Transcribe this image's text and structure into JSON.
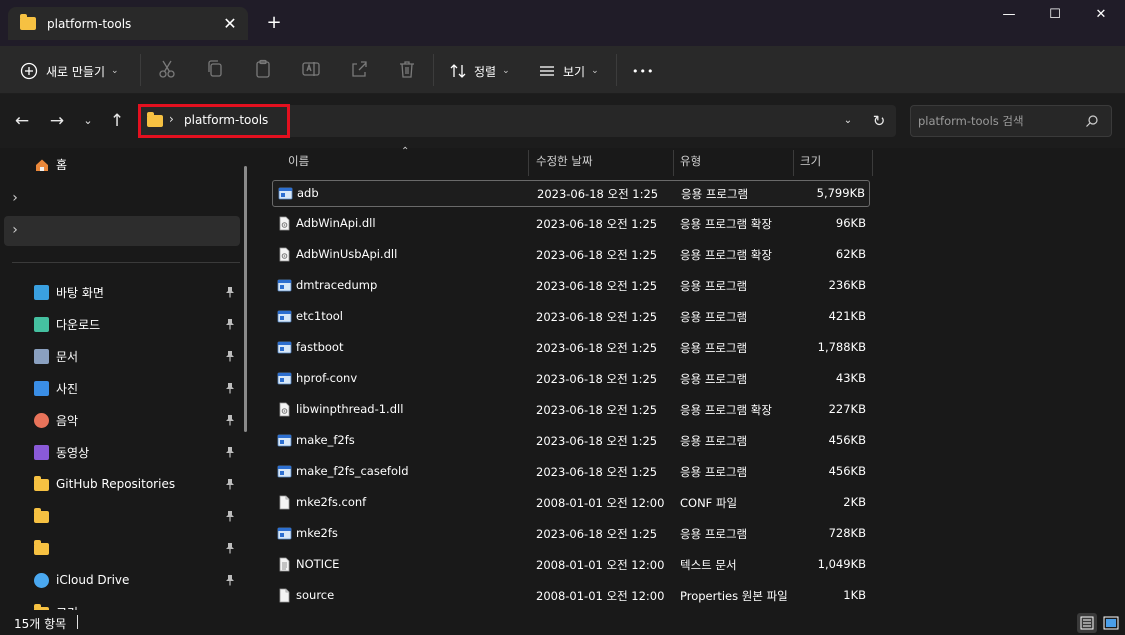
{
  "window": {
    "tab_title": "platform-tools",
    "new_tab": "+",
    "close_tab": "✕",
    "minimize": "—",
    "maximize": "☐",
    "close": "✕"
  },
  "toolbar": {
    "new_label": "새로 만들기",
    "sort_label": "정렬",
    "view_label": "보기",
    "more_label": "•••"
  },
  "address": {
    "separator": "›",
    "path": "platform-tools",
    "search_placeholder": "platform-tools 검색"
  },
  "sidebar": {
    "home_label": "홈",
    "items": [
      {
        "label": "바탕 화면",
        "icon": "desktop-icon",
        "color": "#3aa0e0",
        "pinned": true
      },
      {
        "label": "다운로드",
        "icon": "download-icon",
        "color": "#45c0a0",
        "pinned": true
      },
      {
        "label": "문서",
        "icon": "document-icon",
        "color": "#8aa0c0",
        "pinned": true
      },
      {
        "label": "사진",
        "icon": "picture-icon",
        "color": "#3a8ee6",
        "pinned": true
      },
      {
        "label": "음악",
        "icon": "music-icon",
        "color": "#e8735a",
        "pinned": true
      },
      {
        "label": "동영상",
        "icon": "video-icon",
        "color": "#8a5ad8",
        "pinned": true
      },
      {
        "label": "GitHub Repositories",
        "icon": "folder-icon",
        "color": "#f6c142",
        "pinned": true
      },
      {
        "label": "",
        "icon": "folder-icon",
        "color": "#f6c142",
        "pinned": true
      },
      {
        "label": "",
        "icon": "folder-icon",
        "color": "#f6c142",
        "pinned": true
      },
      {
        "label": "iCloud Drive",
        "icon": "icloud-icon",
        "color": "#4aa8f0",
        "pinned": true
      },
      {
        "label": "크리",
        "icon": "folder-icon",
        "color": "#f6c142",
        "pinned": false
      }
    ]
  },
  "columns": {
    "name": "이름",
    "date": "수정한 날짜",
    "type": "유형",
    "size": "크기"
  },
  "files": [
    {
      "name": "adb",
      "date": "2023-06-18 오전 1:25",
      "type": "응용 프로그램",
      "size": "5,799KB",
      "icon": "app"
    },
    {
      "name": "AdbWinApi.dll",
      "date": "2023-06-18 오전 1:25",
      "type": "응용 프로그램 확장",
      "size": "96KB",
      "icon": "dll"
    },
    {
      "name": "AdbWinUsbApi.dll",
      "date": "2023-06-18 오전 1:25",
      "type": "응용 프로그램 확장",
      "size": "62KB",
      "icon": "dll"
    },
    {
      "name": "dmtracedump",
      "date": "2023-06-18 오전 1:25",
      "type": "응용 프로그램",
      "size": "236KB",
      "icon": "app"
    },
    {
      "name": "etc1tool",
      "date": "2023-06-18 오전 1:25",
      "type": "응용 프로그램",
      "size": "421KB",
      "icon": "app"
    },
    {
      "name": "fastboot",
      "date": "2023-06-18 오전 1:25",
      "type": "응용 프로그램",
      "size": "1,788KB",
      "icon": "app"
    },
    {
      "name": "hprof-conv",
      "date": "2023-06-18 오전 1:25",
      "type": "응용 프로그램",
      "size": "43KB",
      "icon": "app"
    },
    {
      "name": "libwinpthread-1.dll",
      "date": "2023-06-18 오전 1:25",
      "type": "응용 프로그램 확장",
      "size": "227KB",
      "icon": "dll"
    },
    {
      "name": "make_f2fs",
      "date": "2023-06-18 오전 1:25",
      "type": "응용 프로그램",
      "size": "456KB",
      "icon": "app"
    },
    {
      "name": "make_f2fs_casefold",
      "date": "2023-06-18 오전 1:25",
      "type": "응용 프로그램",
      "size": "456KB",
      "icon": "app"
    },
    {
      "name": "mke2fs.conf",
      "date": "2008-01-01 오전 12:00",
      "type": "CONF 파일",
      "size": "2KB",
      "icon": "file"
    },
    {
      "name": "mke2fs",
      "date": "2023-06-18 오전 1:25",
      "type": "응용 프로그램",
      "size": "728KB",
      "icon": "app"
    },
    {
      "name": "NOTICE",
      "date": "2008-01-01 오전 12:00",
      "type": "텍스트 문서",
      "size": "1,049KB",
      "icon": "text"
    },
    {
      "name": "source",
      "date": "2008-01-01 오전 12:00",
      "type": "Properties 원본 파일",
      "size": "1KB",
      "icon": "file"
    }
  ],
  "status": {
    "count": "15개 항목"
  },
  "colors": {
    "accent_highlight": "#e3101f",
    "folder": "#f6c142",
    "background": "#191919"
  }
}
